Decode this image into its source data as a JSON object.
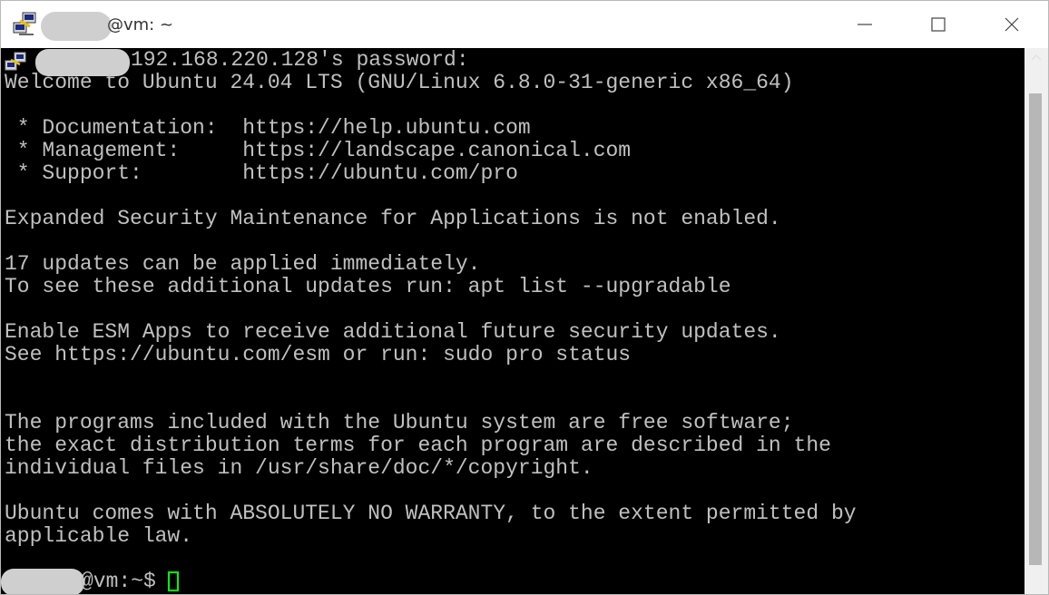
{
  "window": {
    "title": "@vm: ~"
  },
  "terminal": {
    "password_prompt": "192.168.220.128's password:",
    "lines": [
      "Welcome to Ubuntu 24.04 LTS (GNU/Linux 6.8.0-31-generic x86_64)",
      "",
      " * Documentation:  https://help.ubuntu.com",
      " * Management:     https://landscape.canonical.com",
      " * Support:        https://ubuntu.com/pro",
      "",
      "Expanded Security Maintenance for Applications is not enabled.",
      "",
      "17 updates can be applied immediately.",
      "To see these additional updates run: apt list --upgradable",
      "",
      "Enable ESM Apps to receive additional future security updates.",
      "See https://ubuntu.com/esm or run: sudo pro status",
      "",
      "",
      "The programs included with the Ubuntu system are free software;",
      "the exact distribution terms for each program are described in the",
      "individual files in /usr/share/doc/*/copyright.",
      "",
      "Ubuntu comes with ABSOLUTELY NO WARRANTY, to the extent permitted by",
      "applicable law."
    ],
    "shell_prompt": "@vm:~$ "
  },
  "colors": {
    "terminal_bg": "#000000",
    "terminal_fg": "#c0c0c0",
    "cursor": "#00ff00"
  },
  "icons": {
    "app": "putty-icon",
    "minimize": "minimize-icon",
    "maximize": "maximize-icon",
    "close": "close-icon"
  }
}
